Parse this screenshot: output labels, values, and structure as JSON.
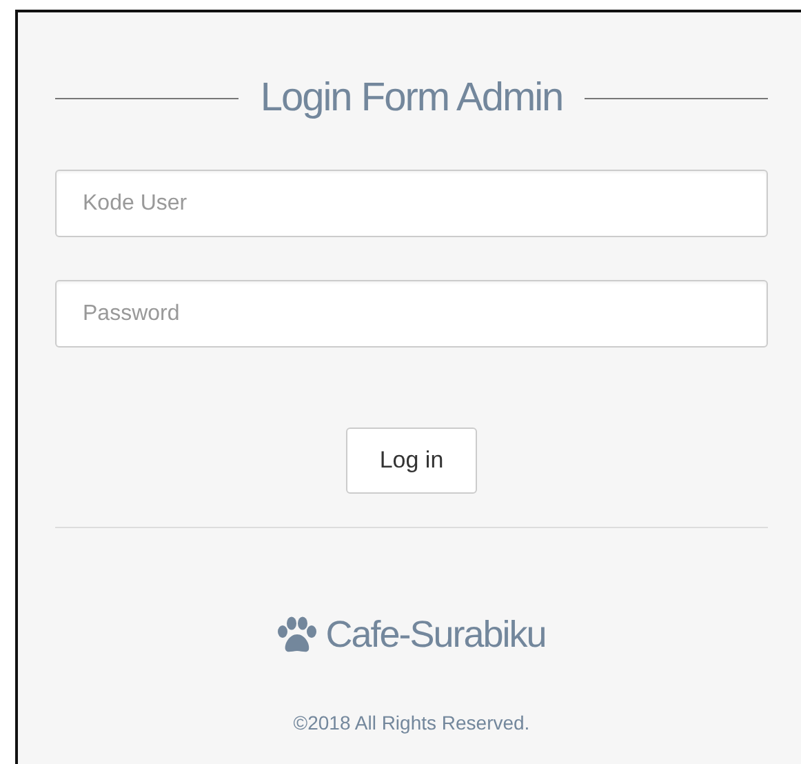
{
  "title": "Login Form Admin",
  "fields": [
    {
      "placeholder": "Kode User"
    },
    {
      "placeholder": "Password"
    }
  ],
  "button": "Log in",
  "brand": "Cafe-Surabiku",
  "footer": "©2018 All Rights Reserved."
}
